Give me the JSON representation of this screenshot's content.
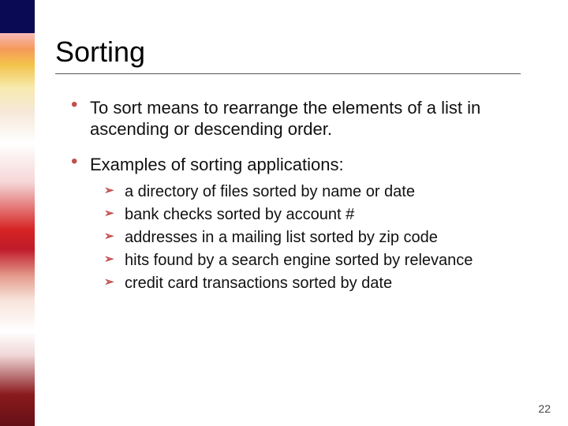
{
  "title": "Sorting",
  "bullets": {
    "b1": "To sort means to rearrange the elements of a list in ascending or descending order.",
    "b2": "Examples of sorting applications:"
  },
  "sub": {
    "s1": "a directory of files sorted by name or date",
    "s2": "bank checks sorted by account #",
    "s3": "addresses in a mailing list sorted by zip code",
    "s4": "hits found by a search engine sorted by relevance",
    "s5": "credit card transactions sorted by date"
  },
  "page_number": "22",
  "glyph": {
    "arrow": "➢"
  }
}
